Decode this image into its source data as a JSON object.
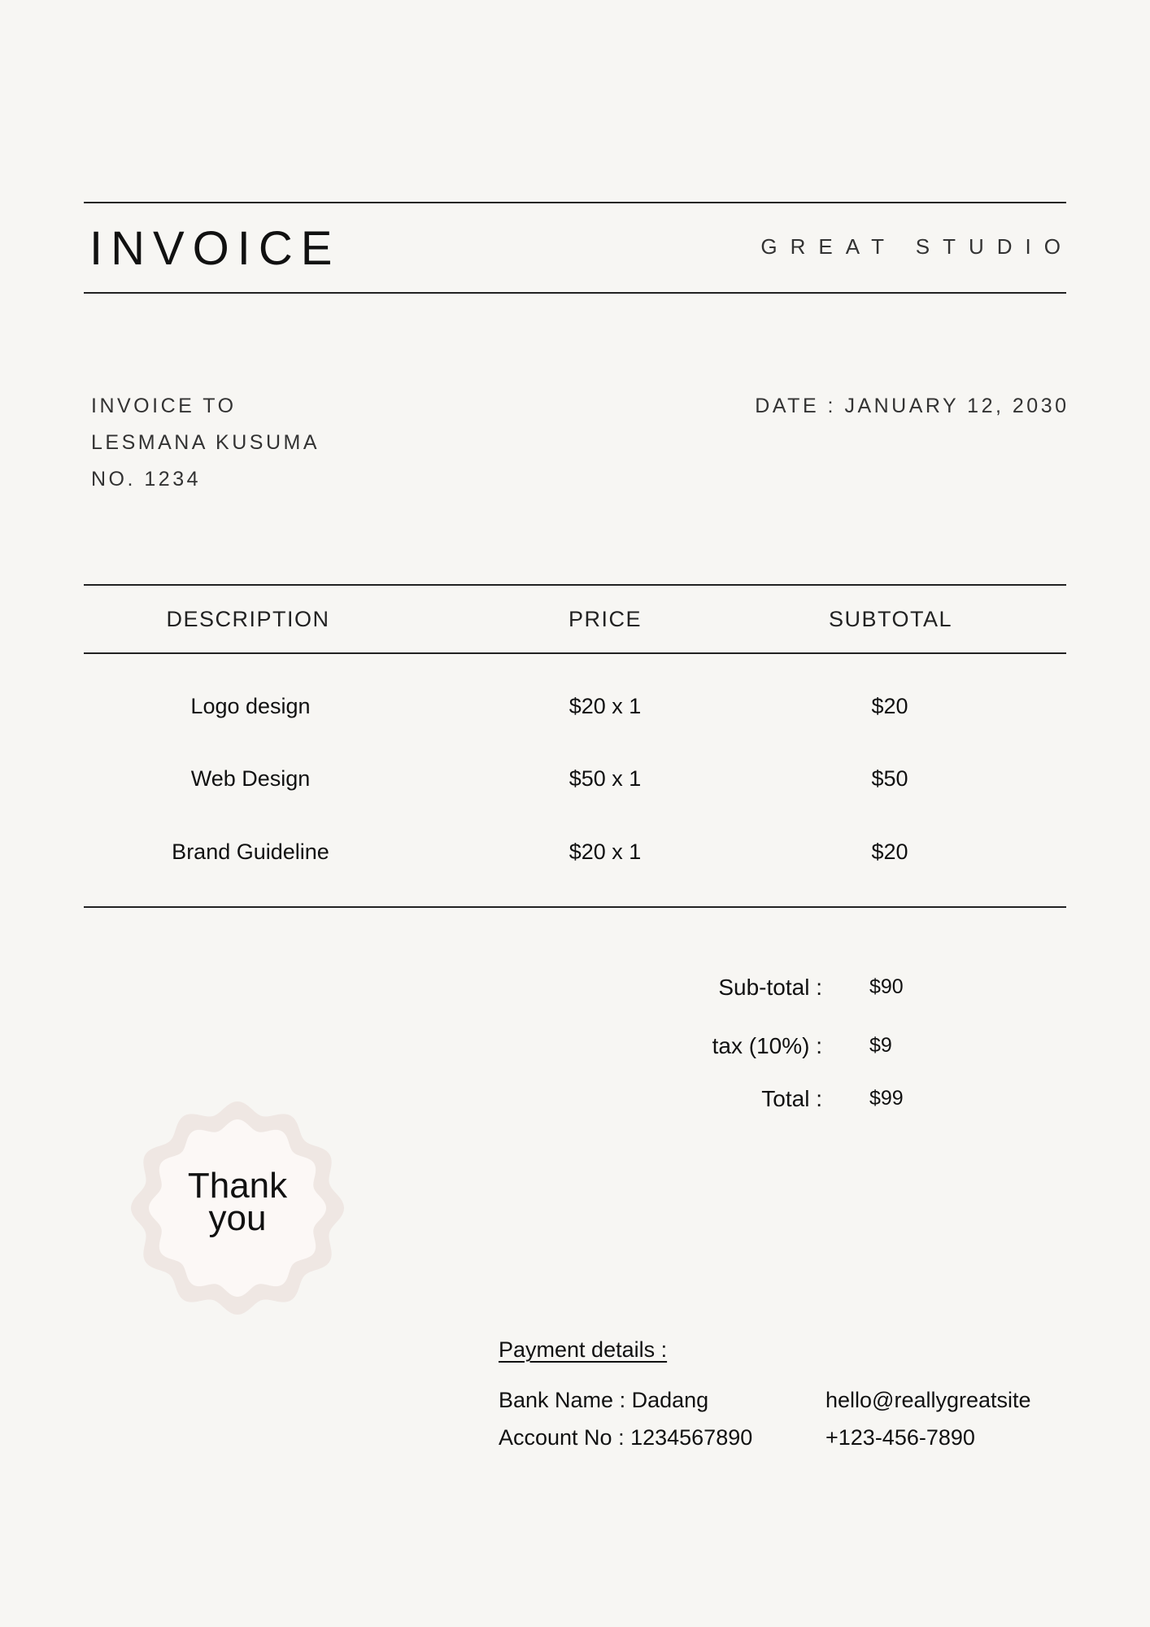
{
  "header": {
    "title": "INVOICE",
    "brand": "GREAT STUDIO"
  },
  "bill_to": {
    "label": "INVOICE TO",
    "name": "LESMANA KUSUMA",
    "number": "NO. 1234"
  },
  "date": "DATE : JANUARY 12, 2030",
  "table": {
    "columns": [
      "DESCRIPTION",
      "PRICE",
      "SUBTOTAL"
    ],
    "rows": [
      {
        "description": "Logo design",
        "price": "$20 x 1",
        "subtotal": "$20"
      },
      {
        "description": "Web Design",
        "price": "$50 x 1",
        "subtotal": "$50"
      },
      {
        "description": "Brand Guideline",
        "price": "$20 x 1",
        "subtotal": "$20"
      }
    ]
  },
  "summary": {
    "subtotal_label": "Sub-total :",
    "subtotal_value": "$90",
    "tax_label": "tax (10%) :",
    "tax_value": "$9",
    "total_label": "Total :",
    "total_value": "$99"
  },
  "seal": {
    "line1": "Thank",
    "line2": "you",
    "color": "#efe7e3",
    "fill": "#fcf8f6"
  },
  "payment": {
    "title": "Payment details :",
    "bank": "Bank Name : Dadang",
    "account": "Account No : 1234567890",
    "email": "hello@reallygreatsite",
    "phone": "+123-456-7890"
  },
  "colors": {
    "background": "#f7f6f3",
    "rule": "#222222"
  }
}
